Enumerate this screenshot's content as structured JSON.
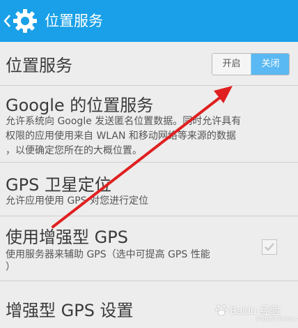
{
  "header": {
    "title": "位置服务",
    "back_icon": "chevron-left-icon",
    "app_icon": "gear-icon"
  },
  "location_service": {
    "title": "位置服务",
    "toggle": {
      "on_label": "开启",
      "off_label": "关闭",
      "selected": "关闭"
    }
  },
  "google_location": {
    "title": "Google 的位置服务",
    "desc_line1": "允许系统向 Google 发送匿名位置数据。同时允许具有",
    "desc_line2": "权限的应用使用来自 WLAN 和移动网络等来源的数据",
    "desc_line3": "，以便确定您所在的大概位置。"
  },
  "gps_satellite": {
    "title": "GPS 卫星定位",
    "desc": "允许应用使用 GPS 对您进行定位"
  },
  "assisted_gps": {
    "title": "使用增强型 GPS",
    "desc_line1": "使用服务器来辅助 GPS（选中可提高 GPS 性能",
    "desc_line2": "）",
    "checked": true
  },
  "enhanced_gps_settings": {
    "title": "增强型 GPS 设置"
  },
  "watermark": {
    "text": "Baidu 经验",
    "sub": "jingyan.baidu.com"
  },
  "colors": {
    "header_bg": "#19a0e8",
    "toggle_selected": "#5ab9f2",
    "annotation_arrow": "#e02020"
  }
}
